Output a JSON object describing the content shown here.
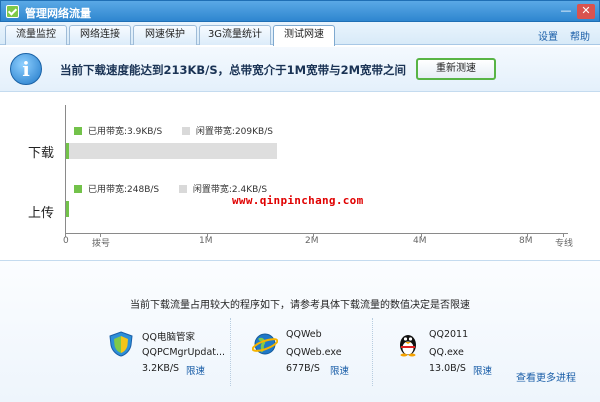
{
  "window": {
    "title": "管理网络流量",
    "minimize_glyph": "—",
    "close_glyph": "✕"
  },
  "tabs": [
    {
      "label": "流量监控",
      "active": false
    },
    {
      "label": "网络连接",
      "active": false
    },
    {
      "label": "网速保护",
      "active": false
    },
    {
      "label": "3G流量统计",
      "active": false
    },
    {
      "label": "测试网速",
      "active": true
    }
  ],
  "top_links": {
    "settings": "设置",
    "help": "帮助"
  },
  "banner": {
    "icon": "info-icon",
    "icon_glyph": "i",
    "message": "当前下载速度能达到213KB/S，总带宽介于1M宽带与2M宽带之间",
    "retest_label": "重新测速"
  },
  "chart_data": {
    "type": "bar",
    "orientation": "horizontal",
    "stacked": true,
    "categories": [
      "下载",
      "上传"
    ],
    "series": [
      {
        "name": "已用带宽",
        "color": "#73c24a",
        "labels": [
          "已用带宽:3.9KB/S",
          "已用带宽:248B/S"
        ],
        "values_kbps": [
          3.9,
          0.242
        ]
      },
      {
        "name": "闲置带宽",
        "color": "#d9d9d9",
        "labels": [
          "闲置带宽:209KB/S",
          "闲置带宽:2.4KB/S"
        ],
        "values_kbps": [
          209,
          2.4
        ]
      }
    ],
    "x_ticks": [
      {
        "label": "0",
        "value": 0
      },
      {
        "label": "拨号",
        "value": 0.5
      },
      {
        "label": "1M",
        "value": 1
      },
      {
        "label": "2M",
        "value": 2
      },
      {
        "label": "4M",
        "value": 4
      },
      {
        "label": "8M",
        "value": 8
      },
      {
        "label": "专线",
        "value": 10
      }
    ],
    "x_unit": "Mbps",
    "watermark": "www.qinpinchang.com"
  },
  "processes": {
    "message": "当前下载流量占用较大的程序如下，请参考具体下载流量的数值决定是否限速",
    "items": [
      {
        "name": "QQ电脑管家",
        "exe": "QQPCMgrUpdat...",
        "rate": "3.2KB/S",
        "limit_label": "限速",
        "icon": "qq-pc-manager-shield-icon"
      },
      {
        "name": "QQWeb",
        "exe": "QQWeb.exe",
        "rate": "677B/S",
        "limit_label": "限速",
        "icon": "qqweb-globe-icon"
      },
      {
        "name": "QQ2011",
        "exe": "QQ.exe",
        "rate": "13.0B/S",
        "limit_label": "限速",
        "icon": "qq-penguin-icon"
      }
    ],
    "more_label": "查看更多进程"
  }
}
